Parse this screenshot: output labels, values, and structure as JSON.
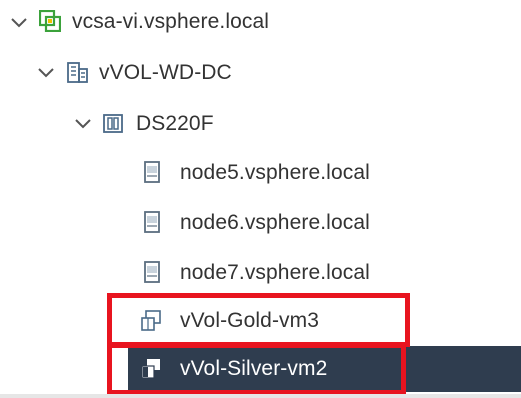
{
  "tree": {
    "items": [
      {
        "label": "vcsa-vi.vsphere.local",
        "icon": "vcenter-icon",
        "expanded": true
      },
      {
        "label": "vVOL-WD-DC",
        "icon": "datacenter-icon",
        "expanded": true
      },
      {
        "label": "DS220F",
        "icon": "cluster-icon",
        "expanded": true
      },
      {
        "label": "node5.vsphere.local",
        "icon": "host-icon"
      },
      {
        "label": "node6.vsphere.local",
        "icon": "host-icon"
      },
      {
        "label": "node7.vsphere.local",
        "icon": "host-icon"
      },
      {
        "label": "vVol-Gold-vm3",
        "icon": "vm-icon",
        "highlighted": true
      },
      {
        "label": "vVol-Silver-vm2",
        "icon": "vm-icon",
        "selected": true,
        "highlighted": true
      }
    ]
  },
  "colors": {
    "selection_bg": "#2f3d4f",
    "highlight_border": "#e8141f",
    "vcenter_icon": "#3ba23b",
    "text": "#333333"
  }
}
